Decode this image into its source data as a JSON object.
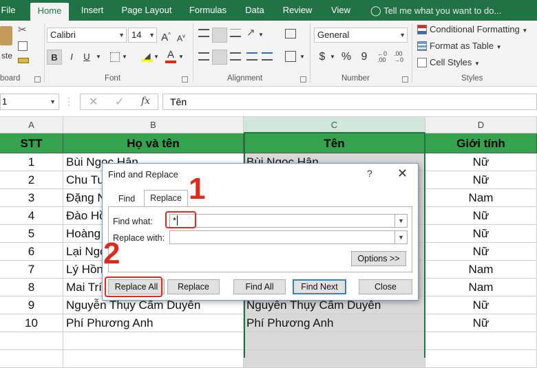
{
  "ribbon_tabs": [
    "File",
    "Home",
    "Insert",
    "Page Layout",
    "Formulas",
    "Data",
    "Review",
    "View"
  ],
  "active_tab": "Home",
  "tell_me": "Tell me what you want to do...",
  "clipboard": {
    "paste_fragment": "ste",
    "label_fragment": "board"
  },
  "font": {
    "name": "Calibri",
    "size": "14",
    "bold": "B",
    "italic": "I",
    "underline": "U",
    "label": "Font"
  },
  "alignment": {
    "label": "Alignment"
  },
  "number": {
    "format": "General",
    "currency": "$",
    "percent": "%",
    "comma": "9",
    "dec_inc": "←.0\n.00",
    "dec_dec": ".00\n→.0",
    "label": "Number"
  },
  "styles": {
    "conditional": "Conditional Formatting",
    "table": "Format as Table",
    "cell_styles": "Cell Styles",
    "label": "Styles"
  },
  "formula_bar": {
    "name_box": "1",
    "fx": "fx",
    "content": "Tên"
  },
  "columns": [
    "A",
    "B",
    "C",
    "D"
  ],
  "header_row": [
    "STT",
    "Họ và tên",
    "Tên",
    "Giới tính"
  ],
  "rows": [
    [
      "1",
      "Bùi Ngọc Hân",
      "Bùi Ngọc Hân",
      "Nữ"
    ],
    [
      "2",
      "Chu Tu",
      "",
      "Nữ"
    ],
    [
      "3",
      "Đặng N",
      "",
      "Nam"
    ],
    [
      "4",
      "Đào Hồ",
      "",
      "Nữ"
    ],
    [
      "5",
      "Hoàng",
      "",
      "Nữ"
    ],
    [
      "6",
      "Lại Ngọ",
      "",
      "Nữ"
    ],
    [
      "7",
      "Lý Hồn",
      "",
      "Nam"
    ],
    [
      "8",
      "Mai Trí",
      "",
      "Nam"
    ],
    [
      "9",
      "Nguyễn Thụy Cẩm Duyên",
      "Nguyễn Thụy Cẩm Duyên",
      "Nữ"
    ],
    [
      "10",
      "Phí Phương Anh",
      "Phí Phương Anh",
      "Nữ"
    ]
  ],
  "dialog": {
    "title": "Find and Replace",
    "help": "?",
    "close": "✕",
    "tab_find": "Find",
    "tab_replace": "Replace",
    "find_label": "Find what:",
    "find_value": "*",
    "replace_label": "Replace with:",
    "replace_value": "",
    "options_button": "Options >>",
    "replace_all_button": "Replace All",
    "replace_button": "Replace",
    "find_all_button": "Find All",
    "find_next_button": "Find Next",
    "close_button": "Close"
  },
  "annotations": {
    "step1": "1",
    "step2": "2"
  },
  "colors": {
    "excel_green": "#217346",
    "header_fill": "#35a24d",
    "annotation_red": "#e0281c"
  }
}
